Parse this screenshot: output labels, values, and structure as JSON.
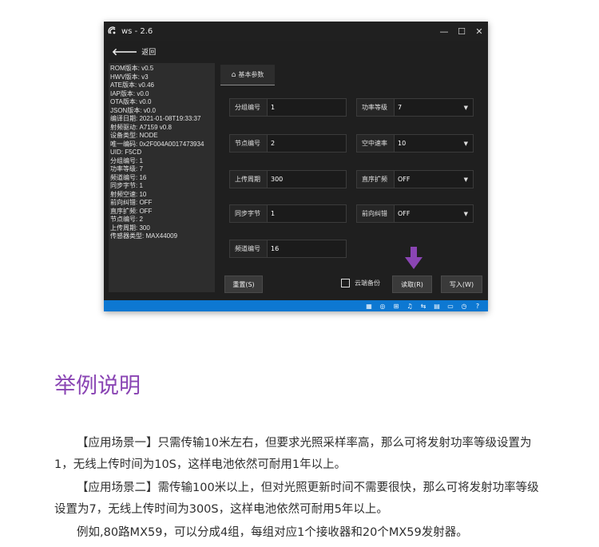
{
  "window": {
    "title": "ws - 2.6",
    "controls": [
      "—",
      "☐",
      "✕"
    ],
    "back_label": "返回",
    "info_lines": [
      "ROM版本: v0.5",
      "HWV版本: v3",
      "ATE版本: v0.46",
      "IAP版本: v0.0",
      "OTA版本: v0.0",
      "JSON版本: v0.0",
      "编译日期:  2021-01-08T19:33:37",
      "射频驱动:  A7159 v0.8",
      "设备类型:  NODE",
      "唯一编码:  0x2F004A0017473934",
      "UID:  F5CD",
      "分组编号:  1",
      "功率等级:  7",
      "频道编号:  16",
      "同步字节:  1",
      "射频空速:  10",
      "前向纠错:  OFF",
      "直序扩频:  OFF",
      "节点编号:  2",
      "上传周期:  300",
      "传感器类型:  MAX44009"
    ],
    "tab_label": "基本参数",
    "fields_left": [
      {
        "label": "分组编号",
        "value": "1"
      },
      {
        "label": "节点编号",
        "value": "2"
      },
      {
        "label": "上传周期",
        "value": "300"
      },
      {
        "label": "同步字节",
        "value": "1"
      },
      {
        "label": "频道编号",
        "value": "16"
      }
    ],
    "fields_right": [
      {
        "label": "功率等级",
        "value": "7"
      },
      {
        "label": "空中速率",
        "value": "10"
      },
      {
        "label": "直序扩频",
        "value": "OFF"
      },
      {
        "label": "前向纠错",
        "value": "OFF"
      }
    ],
    "reset_label": "重置(S)",
    "cloud_label": "云端备份",
    "read_label": "读取(R)",
    "write_label": "写入(W)",
    "accent_color": "#0d78d2",
    "pointer_color": "#8a45b4"
  },
  "article": {
    "heading": "举例说明",
    "paragraphs": [
      "【应用场景一】只需传输10米左右，但要求光照采样率高，那么可将发射功率等级设置为1，无线上传时间为10S，这样电池依然可耐用1年以上。",
      "【应用场景二】需传输100米以上，但对光照更新时间不需要很快，那么可将发射功率等级设置为7，无线上传时间为300S，这样电池依然可耐用5年以上。",
      "例如,80路MX59，可以分成4组，每组对应1个接收器和20个MX59发射器。"
    ],
    "heading_color": "#8a45b4"
  }
}
